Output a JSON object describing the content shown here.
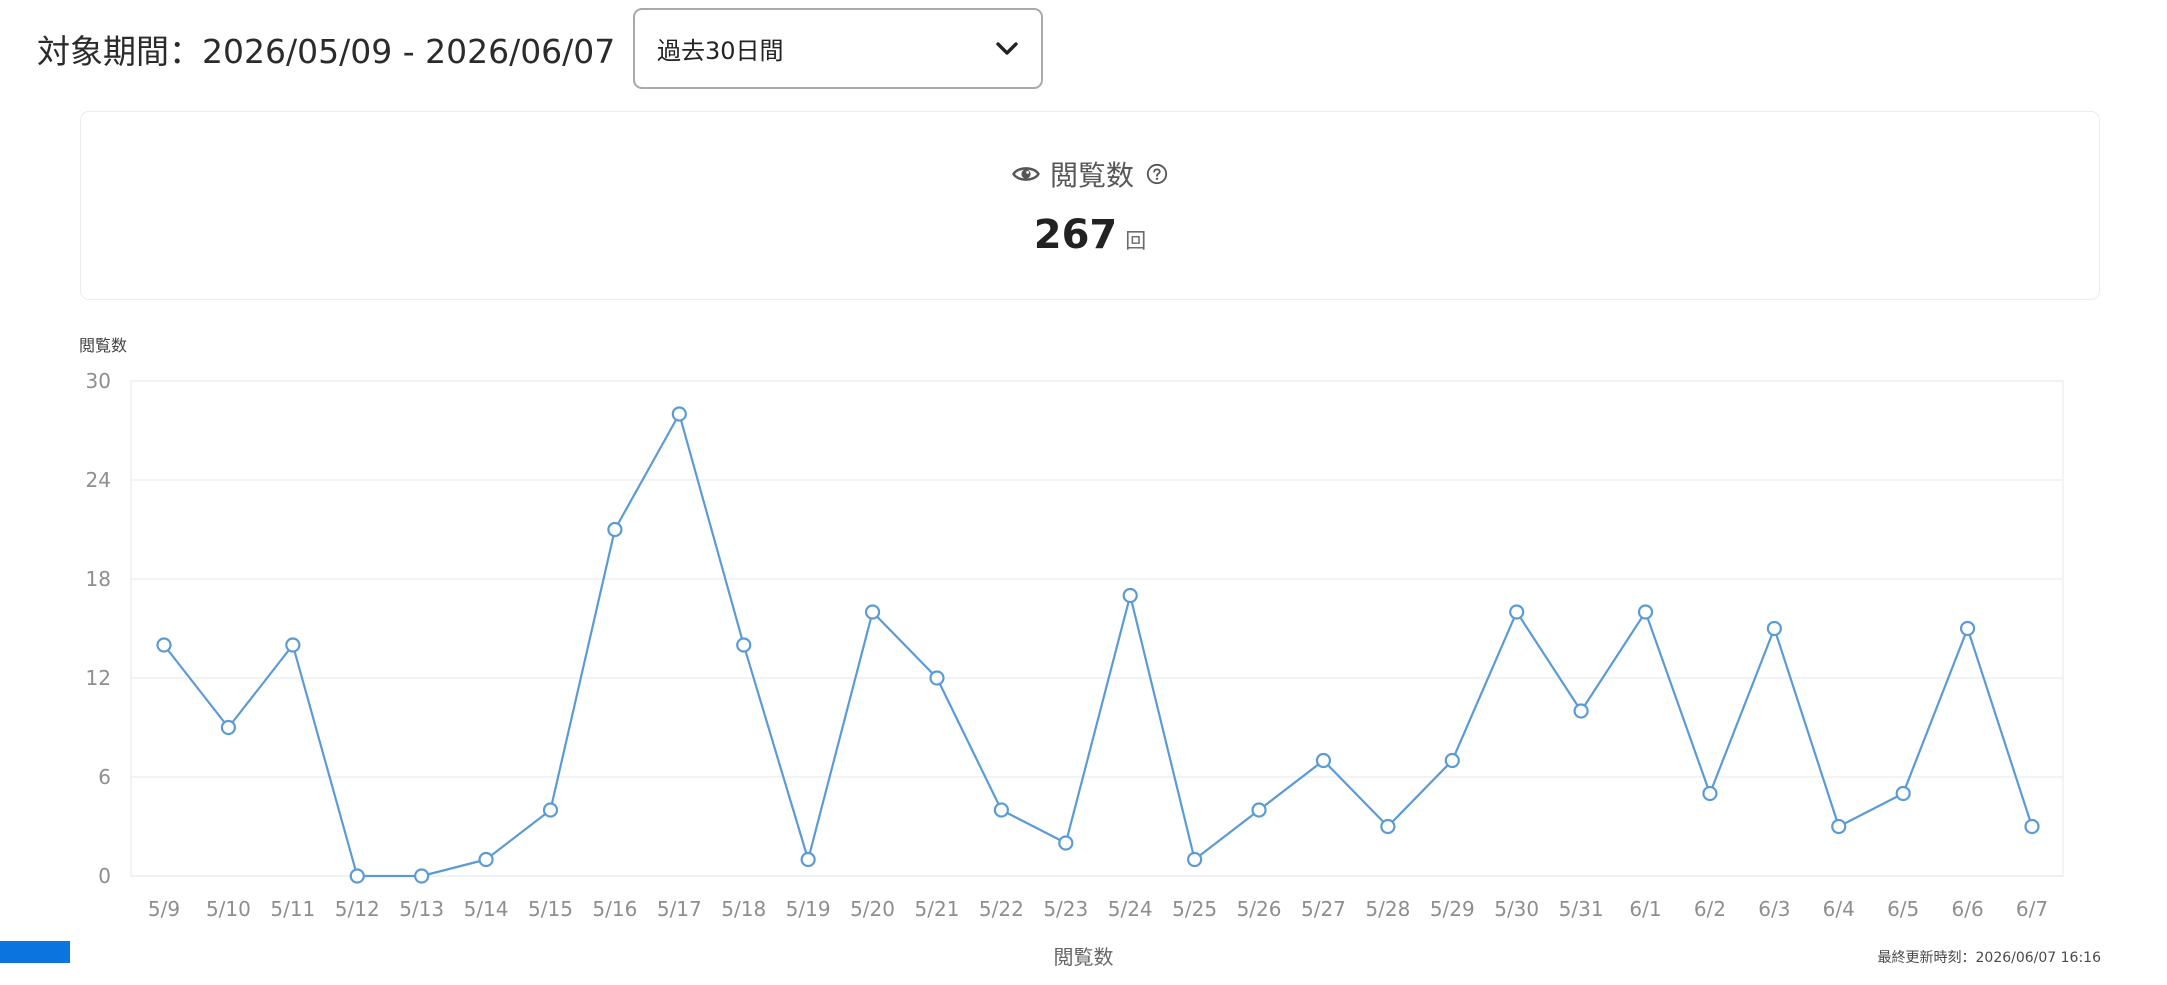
{
  "header": {
    "period_label": "対象期間：2026/05/09 - 2026/06/07",
    "range_select": {
      "value": "過去30日間",
      "icon": "chevron-down-icon"
    }
  },
  "summary": {
    "icon": "eye-icon",
    "label": "閲覧数",
    "help_icon": "question-circle-icon",
    "value": "267",
    "unit": "回"
  },
  "colors": {
    "line": "#5b9bd5",
    "legend_swatch": "#0b74de",
    "grid": "#efefef"
  },
  "chart_data": {
    "type": "line",
    "ylabel": "閲覧数",
    "xlabel": "",
    "ylim": [
      0,
      30
    ],
    "yticks": [
      0,
      6,
      12,
      18,
      24,
      30
    ],
    "categories": [
      "5/9",
      "5/10",
      "5/11",
      "5/12",
      "5/13",
      "5/14",
      "5/15",
      "5/16",
      "5/17",
      "5/18",
      "5/19",
      "5/20",
      "5/21",
      "5/22",
      "5/23",
      "5/24",
      "5/25",
      "5/26",
      "5/27",
      "5/28",
      "5/29",
      "5/30",
      "5/31",
      "6/1",
      "6/2",
      "6/3",
      "6/4",
      "6/5",
      "6/6",
      "6/7"
    ],
    "series": [
      {
        "name": "閲覧数",
        "values": [
          14,
          9,
          14,
          0,
          0,
          1,
          4,
          21,
          28,
          14,
          1,
          16,
          12,
          4,
          2,
          17,
          1,
          4,
          7,
          3,
          7,
          16,
          10,
          16,
          5,
          15,
          3,
          5,
          15,
          3
        ]
      }
    ],
    "grid": true,
    "legend": "bottom-center"
  },
  "footer": {
    "updated": "最終更新時刻：2026/06/07 16:16"
  }
}
